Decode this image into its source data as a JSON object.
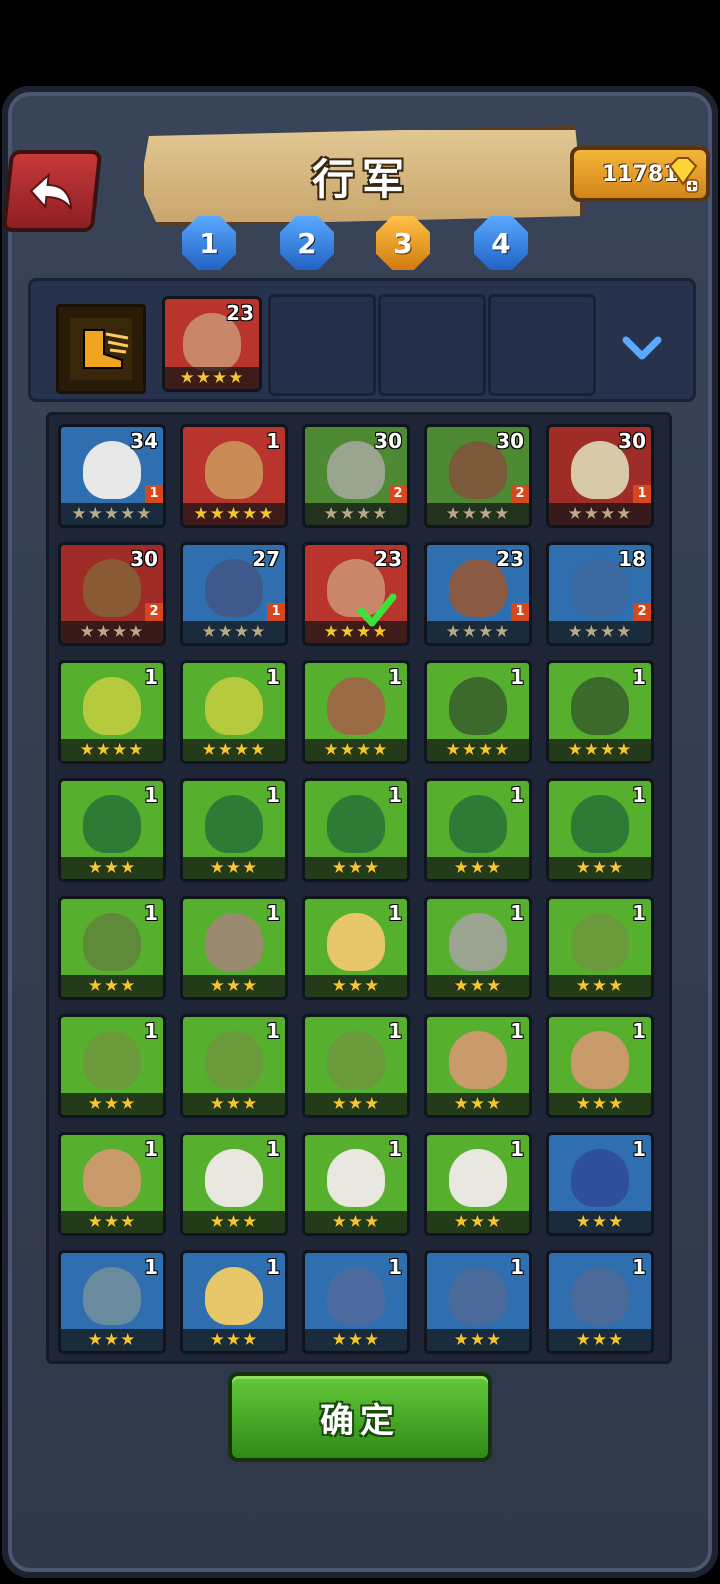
{
  "header": {
    "title": "行军",
    "gems": "11781"
  },
  "tabs": [
    {
      "label": "1",
      "active": false
    },
    {
      "label": "2",
      "active": false
    },
    {
      "label": "3",
      "active": true
    },
    {
      "label": "4",
      "active": false
    }
  ],
  "team": {
    "skill_icon": "boot-icon",
    "slots": [
      {
        "level": "23",
        "stars": "★★★★"
      }
    ]
  },
  "heroes": [
    {
      "level": "34",
      "stars": "★★★★★",
      "rank": "1",
      "bg": "#2f6fb0",
      "face": "#e8e8e8",
      "dim": true
    },
    {
      "level": "1",
      "stars": "★★★★★",
      "rank": "",
      "bg": "#b8342c",
      "face": "#c98a55",
      "dim": false
    },
    {
      "level": "30",
      "stars": "★★★★",
      "rank": "2",
      "bg": "#4e8a34",
      "face": "#9aa48f",
      "dim": true
    },
    {
      "level": "30",
      "stars": "★★★★",
      "rank": "2",
      "bg": "#4e8a34",
      "face": "#7a5a3a",
      "dim": true
    },
    {
      "level": "30",
      "stars": "★★★★",
      "rank": "1",
      "bg": "#a02c28",
      "face": "#d8c9a8",
      "dim": true
    },
    {
      "level": "30",
      "stars": "★★★★",
      "rank": "2",
      "bg": "#a02c28",
      "face": "#8a5a35",
      "dim": true
    },
    {
      "level": "27",
      "stars": "★★★★",
      "rank": "1",
      "bg": "#2f6fb0",
      "face": "#3f5a8a",
      "dim": true
    },
    {
      "level": "23",
      "stars": "★★★★",
      "rank": "",
      "bg": "#b8342c",
      "face": "#c9866a",
      "dim": false,
      "check": true
    },
    {
      "level": "23",
      "stars": "★★★★",
      "rank": "1",
      "bg": "#2f6fb0",
      "face": "#8a5a45",
      "dim": true
    },
    {
      "level": "18",
      "stars": "★★★★",
      "rank": "2",
      "bg": "#2f6fb0",
      "face": "#3c6aa0",
      "dim": true
    },
    {
      "level": "1",
      "stars": "★★★★",
      "rank": "",
      "bg": "#56b02e",
      "face": "#b7c93c",
      "dim": false
    },
    {
      "level": "1",
      "stars": "★★★★",
      "rank": "",
      "bg": "#56b02e",
      "face": "#b7c93c",
      "dim": false
    },
    {
      "level": "1",
      "stars": "★★★★",
      "rank": "",
      "bg": "#56b02e",
      "face": "#9a6a45",
      "dim": false
    },
    {
      "level": "1",
      "stars": "★★★★",
      "rank": "",
      "bg": "#56b02e",
      "face": "#3c6a2c",
      "dim": false
    },
    {
      "level": "1",
      "stars": "★★★★",
      "rank": "",
      "bg": "#56b02e",
      "face": "#3c6a2c",
      "dim": false
    },
    {
      "level": "1",
      "stars": "★★★",
      "rank": "",
      "bg": "#56b02e",
      "face": "#2f7a34",
      "dim": false
    },
    {
      "level": "1",
      "stars": "★★★",
      "rank": "",
      "bg": "#56b02e",
      "face": "#2f7a34",
      "dim": false
    },
    {
      "level": "1",
      "stars": "★★★",
      "rank": "",
      "bg": "#56b02e",
      "face": "#2f7a34",
      "dim": false
    },
    {
      "level": "1",
      "stars": "★★★",
      "rank": "",
      "bg": "#56b02e",
      "face": "#2f7a34",
      "dim": false
    },
    {
      "level": "1",
      "stars": "★★★",
      "rank": "",
      "bg": "#56b02e",
      "face": "#2f7a34",
      "dim": false
    },
    {
      "level": "1",
      "stars": "★★★",
      "rank": "",
      "bg": "#56b02e",
      "face": "#5e8a3a",
      "dim": false
    },
    {
      "level": "1",
      "stars": "★★★",
      "rank": "",
      "bg": "#56b02e",
      "face": "#9a8a70",
      "dim": false
    },
    {
      "level": "1",
      "stars": "★★★",
      "rank": "",
      "bg": "#56b02e",
      "face": "#e8c66a",
      "dim": false
    },
    {
      "level": "1",
      "stars": "★★★",
      "rank": "",
      "bg": "#56b02e",
      "face": "#9aa490",
      "dim": false
    },
    {
      "level": "1",
      "stars": "★★★",
      "rank": "",
      "bg": "#56b02e",
      "face": "#6a9a3c",
      "dim": false
    },
    {
      "level": "1",
      "stars": "★★★",
      "rank": "",
      "bg": "#56b02e",
      "face": "#6a9a3c",
      "dim": false
    },
    {
      "level": "1",
      "stars": "★★★",
      "rank": "",
      "bg": "#56b02e",
      "face": "#6a9a3c",
      "dim": false
    },
    {
      "level": "1",
      "stars": "★★★",
      "rank": "",
      "bg": "#56b02e",
      "face": "#6a9a3c",
      "dim": false
    },
    {
      "level": "1",
      "stars": "★★★",
      "rank": "",
      "bg": "#56b02e",
      "face": "#c99a6a",
      "dim": false
    },
    {
      "level": "1",
      "stars": "★★★",
      "rank": "",
      "bg": "#56b02e",
      "face": "#c99a6a",
      "dim": false
    },
    {
      "level": "1",
      "stars": "★★★",
      "rank": "",
      "bg": "#56b02e",
      "face": "#c99a6a",
      "dim": false
    },
    {
      "level": "1",
      "stars": "★★★",
      "rank": "",
      "bg": "#56b02e",
      "face": "#e8e8e0",
      "dim": false
    },
    {
      "level": "1",
      "stars": "★★★",
      "rank": "",
      "bg": "#56b02e",
      "face": "#e8e8e0",
      "dim": false
    },
    {
      "level": "1",
      "stars": "★★★",
      "rank": "",
      "bg": "#56b02e",
      "face": "#e8e8e0",
      "dim": false
    },
    {
      "level": "1",
      "stars": "★★★",
      "rank": "",
      "bg": "#2f6fb0",
      "face": "#2f4f9a",
      "dim": false
    },
    {
      "level": "1",
      "stars": "★★★",
      "rank": "",
      "bg": "#2f6fb0",
      "face": "#6a8aa0",
      "dim": false
    },
    {
      "level": "1",
      "stars": "★★★",
      "rank": "",
      "bg": "#2f6fb0",
      "face": "#e8c66a",
      "dim": false
    },
    {
      "level": "1",
      "stars": "★★★",
      "rank": "",
      "bg": "#2f6fb0",
      "face": "#4a6aa0",
      "dim": false
    },
    {
      "level": "1",
      "stars": "★★★",
      "rank": "",
      "bg": "#2f6fb0",
      "face": "#4a6a9a",
      "dim": false
    },
    {
      "level": "1",
      "stars": "★★★",
      "rank": "",
      "bg": "#2f6fb0",
      "face": "#4a6a9a",
      "dim": false
    }
  ],
  "confirm_label": "确定"
}
